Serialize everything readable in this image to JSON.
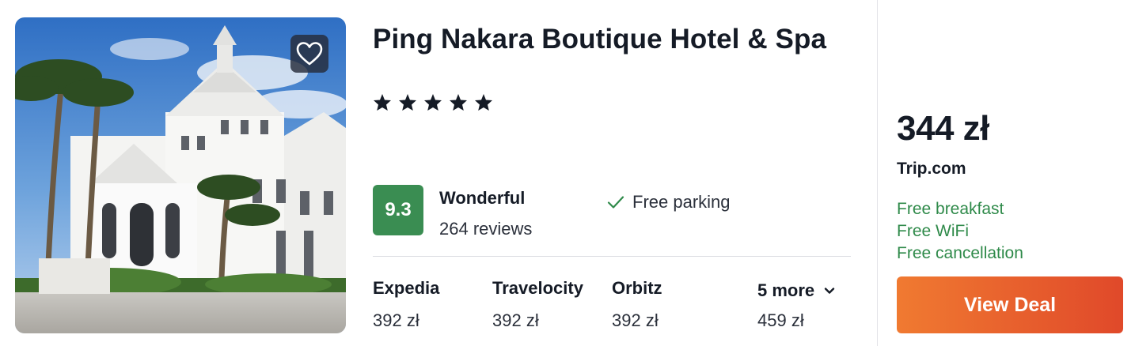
{
  "hotel": {
    "name": "Ping Nakara Boutique Hotel & Spa",
    "star_count": 5,
    "rating": {
      "score": "9.3",
      "label": "Wonderful",
      "reviews": "264 reviews"
    },
    "amenity": "Free parking"
  },
  "providers": [
    {
      "name": "Expedia",
      "price": "392 zł"
    },
    {
      "name": "Travelocity",
      "price": "392 zł"
    },
    {
      "name": "Orbitz",
      "price": "392 zł"
    },
    {
      "name": "5 more",
      "price": "459 zł"
    }
  ],
  "deal": {
    "price": "344 zł",
    "provider": "Trip.com",
    "perks": [
      "Free breakfast",
      "Free WiFi",
      "Free cancellation"
    ],
    "button_label": "View Deal"
  },
  "icons": {
    "favorite": "heart-icon",
    "star": "star-icon",
    "check": "check-icon",
    "expand": "chevron-down-icon"
  },
  "colors": {
    "rating_badge": "#3a8d52",
    "perk_text": "#2f8a4a",
    "button_start": "#f07a31",
    "button_end": "#e0492a"
  }
}
